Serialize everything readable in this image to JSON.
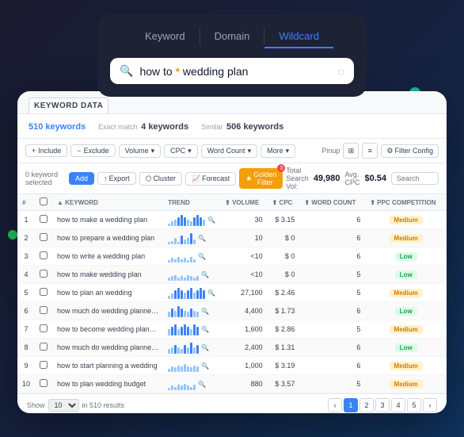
{
  "colors": {
    "accent_blue": "#3b82f6",
    "accent_purple": "#a855f7",
    "accent_teal": "#14b8a6",
    "accent_pink": "#ec4899",
    "accent_green": "#22c55e",
    "accent_gold": "#f59e0b"
  },
  "search_panel": {
    "tabs": [
      {
        "id": "keyword",
        "label": "Keyword",
        "active": false
      },
      {
        "id": "domain",
        "label": "Domain",
        "active": false
      },
      {
        "id": "wildcard",
        "label": "Wildcard",
        "active": true
      }
    ],
    "search_value": "how to * wedding plan",
    "search_placeholder": "how to * wedding plan"
  },
  "card": {
    "header_label": "KEYWORD DATA",
    "stats": [
      {
        "count": "510",
        "label": "keywords",
        "color": "#3b82f6"
      },
      {
        "count": "4",
        "label": "keywords",
        "prefix": "Exact match"
      },
      {
        "count": "506",
        "label": "keywords",
        "prefix": "Similar"
      }
    ],
    "filters": [
      {
        "label": "Include",
        "icon": "+"
      },
      {
        "label": "Exclude",
        "icon": "-"
      },
      {
        "label": "Volume",
        "icon": "▼"
      },
      {
        "label": "CPC",
        "icon": "▼"
      },
      {
        "label": "Word Count",
        "icon": "▼"
      },
      {
        "label": "More",
        "icon": "▼"
      }
    ],
    "pinup_label": "Pinup",
    "filter_config": "Filter Config",
    "actions": {
      "selected": "0 keyword selected",
      "add_btn": "Add",
      "export_btn": "Export",
      "cluster_btn": "Cluster",
      "forecast_btn": "Forecast",
      "golden_btn": "Golden Filter",
      "golden_badge": "3"
    },
    "summary": {
      "total_search_label": "Total Search Vol:",
      "total_search_value": "49,980",
      "avg_cpc_label": "Avg. CPC",
      "avg_cpc_value": "$0.54"
    },
    "table": {
      "columns": [
        "#",
        "",
        "KEYWORD",
        "TREND",
        "VOLUME",
        "CPC",
        "WORD COUNT",
        "PPC COMPETITION"
      ],
      "rows": [
        {
          "num": 1,
          "keyword": "how to make a wedding plan",
          "trend_heights": [
            2,
            4,
            6,
            8,
            10,
            8,
            6,
            4,
            8,
            10,
            8,
            6
          ],
          "volume": "30",
          "cpc": "3.15",
          "word_count": "6",
          "cpc_dollar": "$",
          "competition": "Medium",
          "competition_color": "medium"
        },
        {
          "num": 2,
          "keyword": "how to prepare a wedding plan",
          "trend_heights": [
            2,
            3,
            6,
            2,
            8,
            4,
            6,
            10,
            4
          ],
          "volume": "10",
          "cpc": "0",
          "word_count": "6",
          "cpc_dollar": "$",
          "competition": "Medium",
          "competition_color": "medium"
        },
        {
          "num": 3,
          "keyword": "how to write a wedding plan",
          "trend_heights": [
            2,
            4,
            3,
            5,
            3,
            4,
            2,
            5,
            3
          ],
          "volume": "<10",
          "cpc": "0",
          "word_count": "6",
          "cpc_dollar": "$",
          "competition": "Low",
          "competition_color": "low"
        },
        {
          "num": 4,
          "keyword": "how to make wedding plan",
          "trend_heights": [
            3,
            4,
            5,
            3,
            4,
            3,
            5,
            4,
            3,
            4
          ],
          "volume": "<10",
          "cpc": "0",
          "word_count": "5",
          "cpc_dollar": "$",
          "competition": "Low",
          "competition_color": "low"
        },
        {
          "num": 5,
          "keyword": "how to plan an wedding",
          "trend_heights": [
            3,
            5,
            8,
            10,
            8,
            6,
            8,
            10,
            6,
            8,
            10,
            8
          ],
          "volume": "27,100",
          "cpc": "2.46",
          "word_count": "5",
          "cpc_dollar": "$",
          "competition": "Medium",
          "competition_color": "medium"
        },
        {
          "num": 6,
          "keyword": "how much do wedding planner cost",
          "trend_heights": [
            5,
            8,
            6,
            10,
            8,
            6,
            5,
            8,
            6,
            5
          ],
          "volume": "4,400",
          "cpc": "1.73",
          "word_count": "6",
          "cpc_dollar": "$",
          "competition": "Low",
          "competition_color": "low"
        },
        {
          "num": 7,
          "keyword": "how to become wedding planner",
          "trend_heights": [
            6,
            8,
            10,
            6,
            8,
            10,
            8,
            6,
            10,
            8
          ],
          "volume": "1,600",
          "cpc": "2.86",
          "word_count": "5",
          "cpc_dollar": "$",
          "competition": "Medium",
          "competition_color": "medium"
        },
        {
          "num": 8,
          "keyword": "how much do wedding planner make",
          "trend_heights": [
            4,
            6,
            8,
            6,
            4,
            8,
            6,
            10,
            6,
            8
          ],
          "volume": "2,400",
          "cpc": "1.31",
          "word_count": "6",
          "cpc_dollar": "$",
          "competition": "Low",
          "competition_color": "low"
        },
        {
          "num": 9,
          "keyword": "how to start planning a wedding",
          "trend_heights": [
            3,
            5,
            4,
            6,
            5,
            7,
            5,
            4,
            6,
            5
          ],
          "volume": "1,000",
          "cpc": "3.19",
          "word_count": "6",
          "cpc_dollar": "$",
          "competition": "Medium",
          "competition_color": "medium"
        },
        {
          "num": 10,
          "keyword": "how to plan wedding budget",
          "trend_heights": [
            2,
            4,
            3,
            5,
            4,
            6,
            4,
            3,
            5
          ],
          "volume": "880",
          "cpc": "3.57",
          "word_count": "5",
          "cpc_dollar": "$",
          "competition": "Medium",
          "competition_color": "medium"
        }
      ]
    },
    "footer": {
      "show_label": "Show",
      "show_value": "10",
      "results_text": "in 510 results",
      "pages": [
        "1",
        "2",
        "3",
        "4",
        "5"
      ]
    }
  }
}
